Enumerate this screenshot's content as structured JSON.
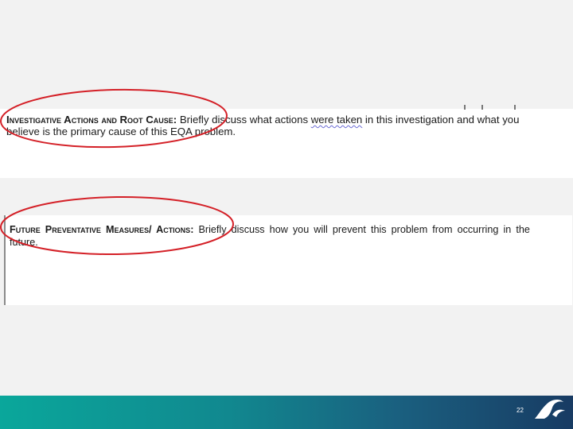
{
  "section1": {
    "heading": "Investigative Actions and Root Cause",
    "colon": ":",
    "lead": " Briefly discuss what actions ",
    "underlined": "were taken",
    "line1_rest": " in this investigation and what you",
    "line2": "believe is the primary cause of this EQA problem."
  },
  "section2": {
    "heading": "Future Preventative Measures/ Actions",
    "colon": ":",
    "line1": " Briefly discuss how you will prevent this problem from occurring in the",
    "line2": "future."
  },
  "footer": {
    "page_number": "22"
  },
  "colors": {
    "annotation": "#d42027",
    "footer_start": "#0aa79b",
    "footer_end": "#183b63"
  }
}
